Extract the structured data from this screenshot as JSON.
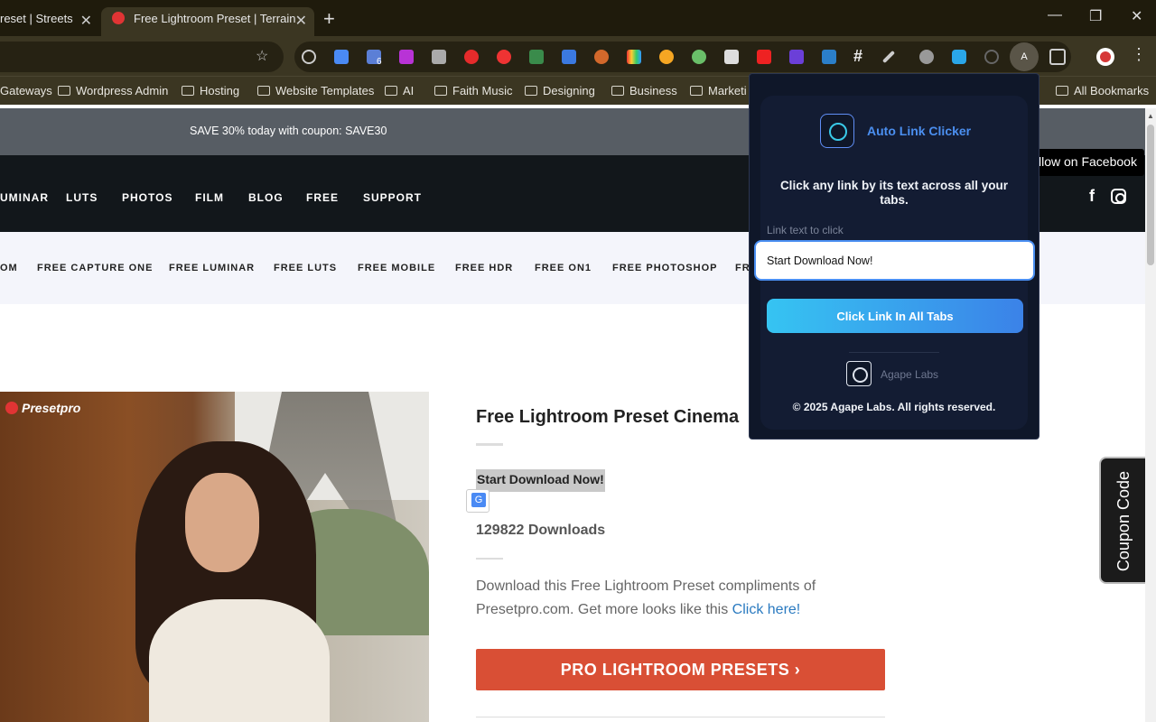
{
  "browser": {
    "tabs": [
      {
        "title": "reset | Streets"
      },
      {
        "title": "Free Lightroom Preset | Terrain"
      }
    ],
    "new_tab": "+",
    "extensions_badge": "6",
    "active_extension_letter": "A",
    "bookmarks": [
      {
        "label": "Gateways",
        "folder": false
      },
      {
        "label": "Wordpress Admin",
        "folder": true
      },
      {
        "label": "Hosting",
        "folder": true
      },
      {
        "label": "Website Templates",
        "folder": true
      },
      {
        "label": "AI",
        "folder": true
      },
      {
        "label": "Faith Music",
        "folder": true
      },
      {
        "label": "Designing",
        "folder": true
      },
      {
        "label": "Business",
        "folder": true
      },
      {
        "label": "Marketi",
        "folder": true
      },
      {
        "label": "All Bookmarks",
        "folder": true
      }
    ]
  },
  "page": {
    "coupon_bar": "SAVE 30% today with coupon: SAVE30",
    "main_nav": [
      "UMINAR",
      "LUTS",
      "PHOTOS",
      "FILM",
      "BLOG",
      "FREE",
      "SUPPORT"
    ],
    "facebook_tooltip": "llow on Facebook",
    "sub_nav": [
      "OM",
      "FREE CAPTURE ONE",
      "FREE LUMINAR",
      "FREE LUTS",
      "FREE MOBILE",
      "FREE HDR",
      "FREE ON1",
      "FREE PHOTOSHOP",
      "FR"
    ],
    "photo_watermark": "Presetpro",
    "product": {
      "title": "Free Lightroom Preset Cinema",
      "download_link": "Start Download Now!",
      "downloads": "129822 Downloads",
      "description": "Download this Free Lightroom Preset compliments of Presetpro.com. Get more looks like this ",
      "description_link": "Click here!",
      "cta": "PRO LIGHTROOM PRESETS  ›"
    },
    "coupon_tab": "Coupon Code"
  },
  "popup": {
    "name": "Auto Link Clicker",
    "description": "Click any link by its text across all your tabs.",
    "field_label": "Link text to click",
    "field_value": "Start Download Now!",
    "button": "Click Link In All Tabs",
    "company": "Agape Labs",
    "copyright": "© 2025 Agape Labs. All rights reserved."
  },
  "colors": {
    "accent": "#4b8ff0",
    "cta": "#d94f35",
    "chrome": "#3b3622"
  }
}
